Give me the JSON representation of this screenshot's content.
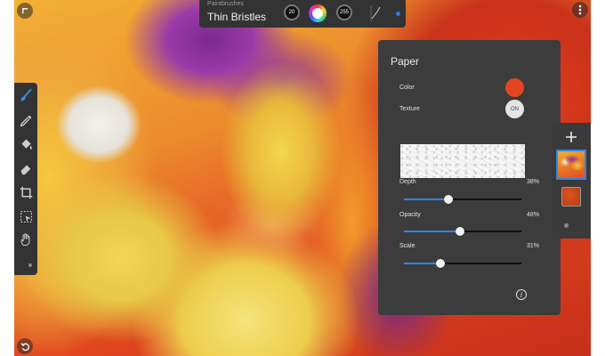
{
  "brush_bar": {
    "category": "Paintbrushes",
    "brush_name": "Thin Bristles",
    "size_value": "20",
    "opacity_value": "255"
  },
  "paper_panel": {
    "title": "Paper",
    "color_label": "Color",
    "color_value": "#e2451f",
    "texture_label": "Texture",
    "texture_toggle": "ON",
    "sliders": [
      {
        "label": "Depth",
        "value_text": "38%",
        "value": 38
      },
      {
        "label": "Opacity",
        "value_text": "48%",
        "value": 48
      },
      {
        "label": "Scale",
        "value_text": "31%",
        "value": 31
      }
    ],
    "info_icon": "info-icon"
  },
  "toolbar": {
    "tools": [
      "paintbrush-icon",
      "eyedropper-icon",
      "paint-bucket-icon",
      "eraser-icon",
      "crop-icon",
      "selection-icon",
      "hand-icon"
    ],
    "active_tool": "paintbrush-icon"
  },
  "layers": {
    "add_icon": "plus-icon"
  },
  "colors": {
    "accent": "#2f86e6",
    "panel": "#3c3c3c"
  }
}
